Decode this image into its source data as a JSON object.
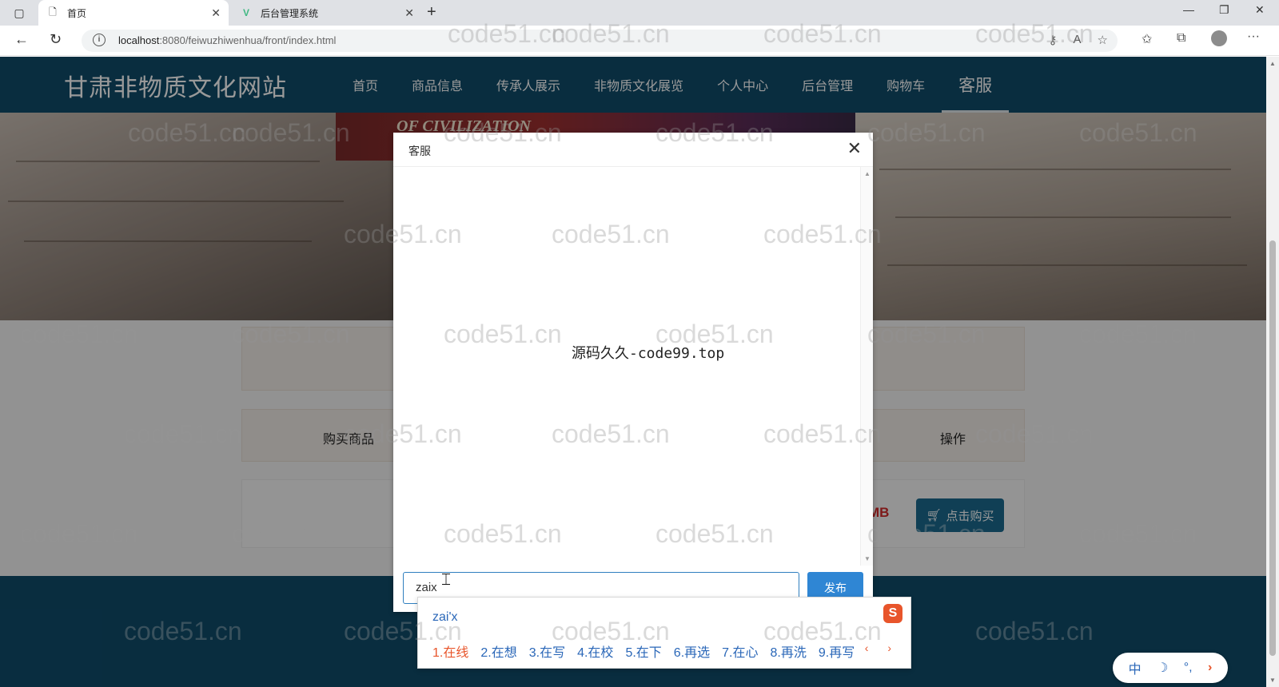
{
  "browser": {
    "tabs": [
      {
        "title": "首页",
        "active": true
      },
      {
        "title": "后台管理系统",
        "active": false
      }
    ],
    "url": {
      "host": "localhost",
      "path": ":8080/feiwuzhiwenhua/front/index.html"
    }
  },
  "site": {
    "title": "甘肃非物质文化网站",
    "nav": [
      {
        "label": "首页"
      },
      {
        "label": "商品信息"
      },
      {
        "label": "传承人展示"
      },
      {
        "label": "非物质文化展览"
      },
      {
        "label": "个人中心"
      },
      {
        "label": "后台管理"
      },
      {
        "label": "购物车"
      },
      {
        "label": "客服",
        "active": true
      }
    ],
    "banner_text": "OF CIVILIZATION",
    "table_header": {
      "col1": "购买商品",
      "col2": "操作"
    },
    "price_tail": "MB",
    "buy_button": "点击购买"
  },
  "modal": {
    "title": "客服",
    "message": "源码久久-code99.top",
    "input_value": "zaix",
    "send_label": "发布"
  },
  "ime": {
    "pinyin": "zai'x",
    "candidates": [
      "1.在线",
      "2.在想",
      "3.在写",
      "4.在校",
      "5.在下",
      "6.再选",
      "7.在心",
      "8.再洗",
      "9.再写"
    ],
    "pager": "‹ ›",
    "toolbar": {
      "lang": "中",
      "moon": "☽",
      "punct": "°,",
      "arrow": "›"
    }
  },
  "watermark_text": "code51.cn",
  "colors": {
    "header": "#0f4b6a",
    "send_button": "#2f86d4",
    "ime_accent": "#e8552b"
  }
}
